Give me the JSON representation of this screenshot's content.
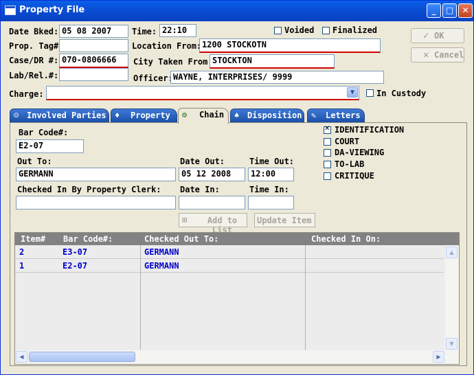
{
  "window": {
    "title": "Property File",
    "minimize": "_",
    "maximize": "□",
    "close": "✕"
  },
  "form": {
    "date_bked_label": "Date Bked:",
    "date_bked": "05 08 2007",
    "time_label": "Time:",
    "time": "22:10",
    "voided_label": "Voided",
    "finalized_label": "Finalized",
    "prop_tag_label": "Prop. Tag#:",
    "prop_tag": "",
    "location_from_label": "Location From:",
    "location_from": "1200 STOCKOTN",
    "case_dr_label": "Case/DR #:",
    "case_dr": "070-0806666",
    "city_taken_label": "City Taken From:",
    "city_taken": "STOCKTON",
    "lab_rel_label": "Lab/Rel.#:",
    "lab_rel": "",
    "officer_label": "Officer:",
    "officer": "WAYNE, INTERPRISES/ 9999",
    "charge_label": "Charge:",
    "charge": "",
    "in_custody_label": "In Custody"
  },
  "buttons": {
    "ok": "OK",
    "cancel": "Cancel",
    "ok_icon": "check-icon",
    "cancel_icon": "x-icon"
  },
  "tabs": [
    {
      "label": "Involved Parties",
      "icon": "person-icon"
    },
    {
      "label": "Property",
      "icon": "bag-icon"
    },
    {
      "label": "Chain",
      "icon": "chain-icon"
    },
    {
      "label": "Disposition",
      "icon": "disposition-icon"
    },
    {
      "label": "Letters",
      "icon": "letters-icon"
    }
  ],
  "chain": {
    "bar_code_label": "Bar Code#:",
    "bar_code": "E2-07",
    "out_to_label": "Out To:",
    "out_to": "GERMANN",
    "date_out_label": "Date Out:",
    "date_out": "05 12 2008",
    "time_out_label": "Time Out:",
    "time_out": "12:00",
    "checked_in_by_label": "Checked In By Property Clerk:",
    "checked_in_by": "",
    "date_in_label": "Date In:",
    "date_in": "",
    "time_in_label": "Time In:",
    "time_in": "",
    "checkboxes": [
      {
        "label": "IDENTIFICATION",
        "checked": true
      },
      {
        "label": "COURT",
        "checked": false
      },
      {
        "label": "DA-VIEWING",
        "checked": false
      },
      {
        "label": "TO-LAB",
        "checked": false
      },
      {
        "label": "CRITIQUE",
        "checked": false
      }
    ],
    "add_to_list": "Add to List",
    "update_item": "Update Item"
  },
  "grid": {
    "headers": [
      "Item#",
      "Bar Code#:",
      "Checked Out To:",
      "Checked In On:"
    ],
    "rows": [
      {
        "item": "2",
        "bar_code": "E3-07",
        "out_to": "GERMANN",
        "in_on": ""
      },
      {
        "item": "1",
        "bar_code": "E2-07",
        "out_to": "GERMANN",
        "in_on": ""
      }
    ]
  },
  "colors": {
    "title_bar": "#0a4fd6",
    "required_underline": "#d00000",
    "grid_text": "#0000cc",
    "grid_header": "#828282"
  }
}
